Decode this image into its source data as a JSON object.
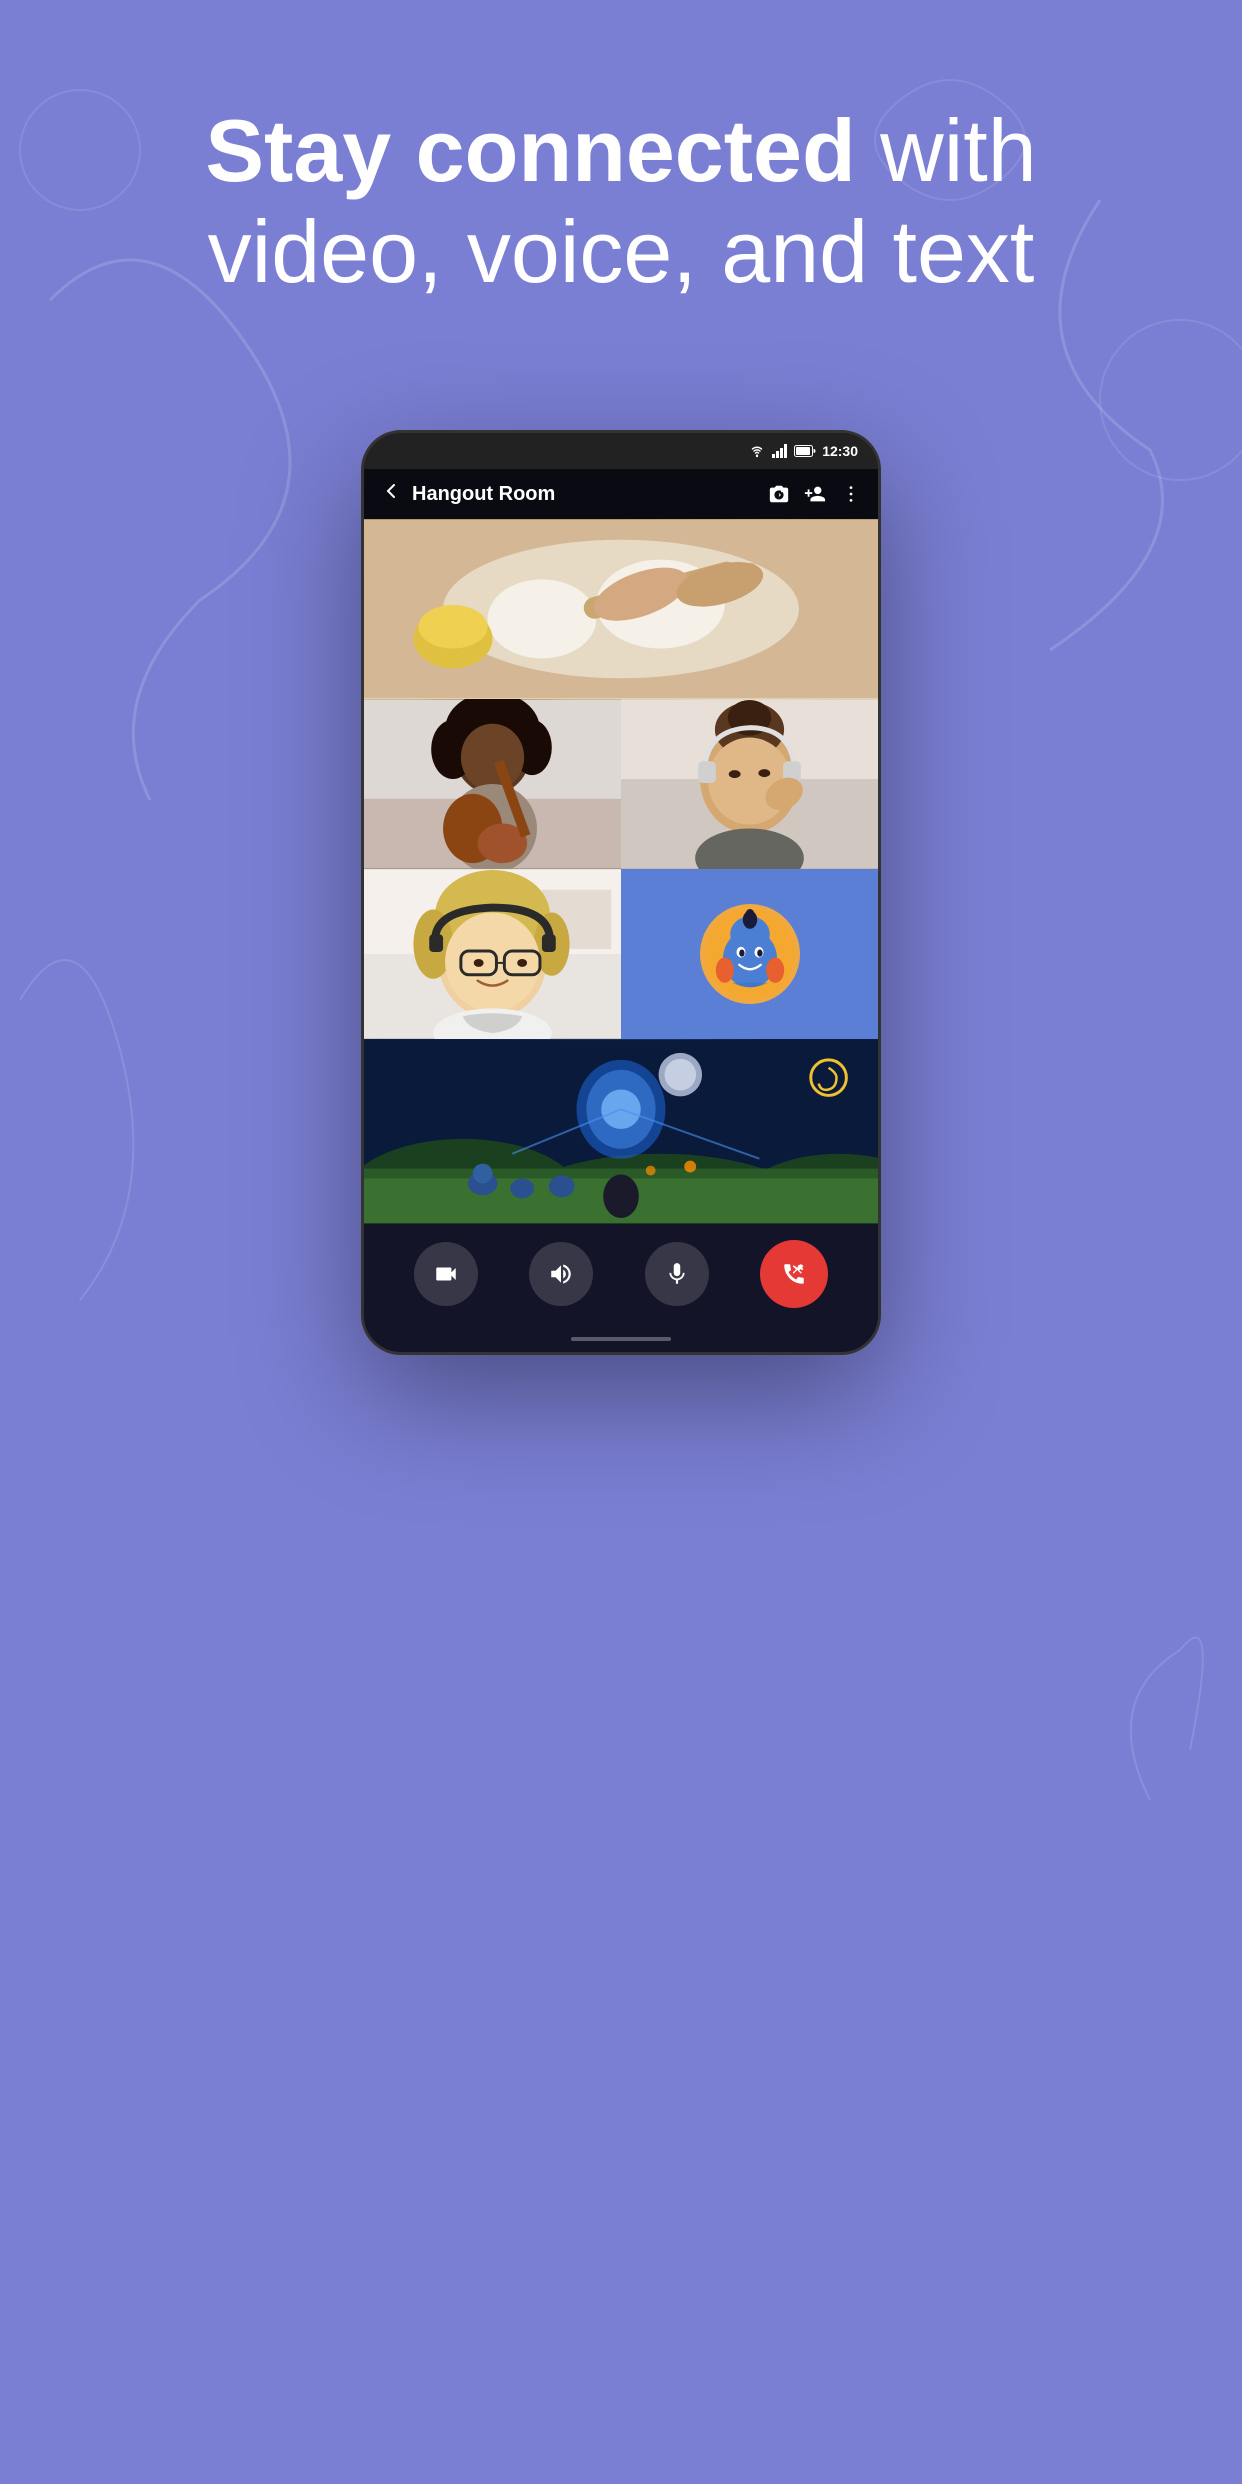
{
  "background": {
    "color": "#7b7fd4"
  },
  "hero": {
    "line1_bold": "Stay connected",
    "line1_regular": " with",
    "line2": "video, voice, and text"
  },
  "status_bar": {
    "time": "12:30",
    "wifi": "wifi",
    "signal": "signal",
    "battery": "battery"
  },
  "app_header": {
    "back_icon": "chevron-down",
    "title": "Hangout Room",
    "camera_icon": "camera-switch",
    "add_person_icon": "add-person",
    "more_icon": "more-vertical"
  },
  "video_cells": [
    {
      "id": "cooking",
      "type": "full",
      "label": "Cooking video"
    },
    {
      "id": "guitar",
      "type": "half",
      "label": "Guitar player"
    },
    {
      "id": "headphones",
      "type": "half",
      "label": "Headphones user"
    },
    {
      "id": "smiling",
      "type": "half",
      "label": "Smiling person"
    },
    {
      "id": "avatar",
      "type": "half",
      "label": "Animated avatar"
    },
    {
      "id": "game",
      "type": "full",
      "label": "Game screen"
    }
  ],
  "controls": [
    {
      "id": "video",
      "label": "Video",
      "icon": "video-camera"
    },
    {
      "id": "audio",
      "label": "Audio",
      "icon": "speaker"
    },
    {
      "id": "mic",
      "label": "Microphone",
      "icon": "microphone"
    },
    {
      "id": "end_call",
      "label": "End Call",
      "icon": "phone-end",
      "accent": true
    }
  ]
}
